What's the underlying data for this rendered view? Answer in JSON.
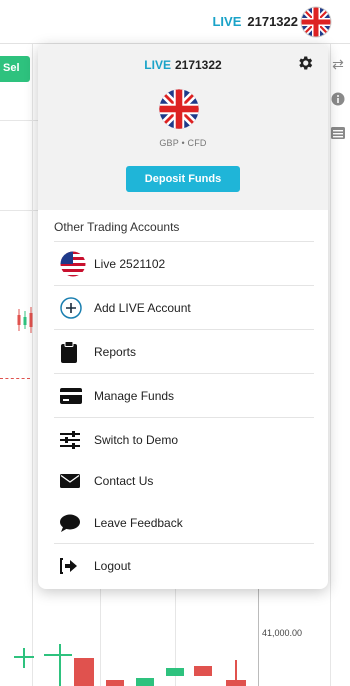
{
  "topbar": {
    "live_label": "LIVE",
    "account_number": "2171322",
    "flag_icon": "uk-flag-icon"
  },
  "background": {
    "sell_label": "Sel",
    "price_label": "41,000.00",
    "accent_buy": "#2ec27e",
    "accent_sell": "#e0524e"
  },
  "panel": {
    "live_label": "LIVE",
    "account_number": "2171322",
    "account_sub": "GBP • CFD",
    "deposit_label": "Deposit Funds",
    "section_title": "Other Trading Accounts",
    "items": [
      {
        "label": "Live 2521102",
        "icon": "us-flag-icon"
      },
      {
        "label": "Add LIVE Account",
        "icon": "plus-circle-icon"
      },
      {
        "label": "Reports",
        "icon": "clipboard-icon"
      },
      {
        "label": "Manage Funds",
        "icon": "credit-card-icon"
      },
      {
        "label": "Switch to Demo",
        "icon": "sliders-icon"
      },
      {
        "label": "Contact Us",
        "icon": "envelope-icon"
      },
      {
        "label": "Leave Feedback",
        "icon": "chat-bubble-icon"
      },
      {
        "label": "Logout",
        "icon": "logout-icon"
      }
    ],
    "accent": "#1fb5d8"
  }
}
